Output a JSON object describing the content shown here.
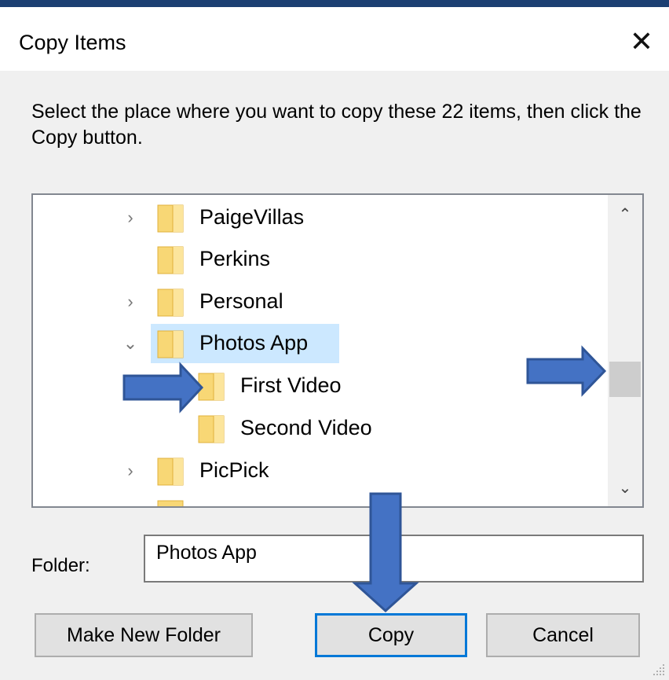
{
  "dialog": {
    "title": "Copy Items",
    "close_symbol": "✕",
    "instructions": "Select the place where you want to copy these 22 items, then click the Copy button."
  },
  "tree": {
    "items": [
      {
        "label": "PaigeVillas",
        "expander": "›",
        "expanded": false,
        "selected": false,
        "level": 0
      },
      {
        "label": "Perkins",
        "expander": "",
        "expanded": false,
        "selected": false,
        "level": 0
      },
      {
        "label": "Personal",
        "expander": "›",
        "expanded": false,
        "selected": false,
        "level": 0
      },
      {
        "label": "Photos App",
        "expander": "⌄",
        "expanded": true,
        "selected": true,
        "level": 0
      },
      {
        "label": "First Video",
        "expander": "",
        "expanded": false,
        "selected": false,
        "level": 1
      },
      {
        "label": "Second Video",
        "expander": "",
        "expanded": false,
        "selected": false,
        "level": 1
      },
      {
        "label": "PicPick",
        "expander": "›",
        "expanded": false,
        "selected": false,
        "level": 0
      }
    ],
    "scroll_up": "⌃",
    "scroll_down": "⌄"
  },
  "folder": {
    "label": "Folder:",
    "value": "Photos App"
  },
  "buttons": {
    "make_new_folder": "Make New Folder",
    "copy": "Copy",
    "cancel": "Cancel"
  },
  "colors": {
    "selection": "#cce8ff",
    "folder": "#f8d775",
    "annotation_arrow": "#4472c4",
    "default_button_border": "#0078d7"
  }
}
